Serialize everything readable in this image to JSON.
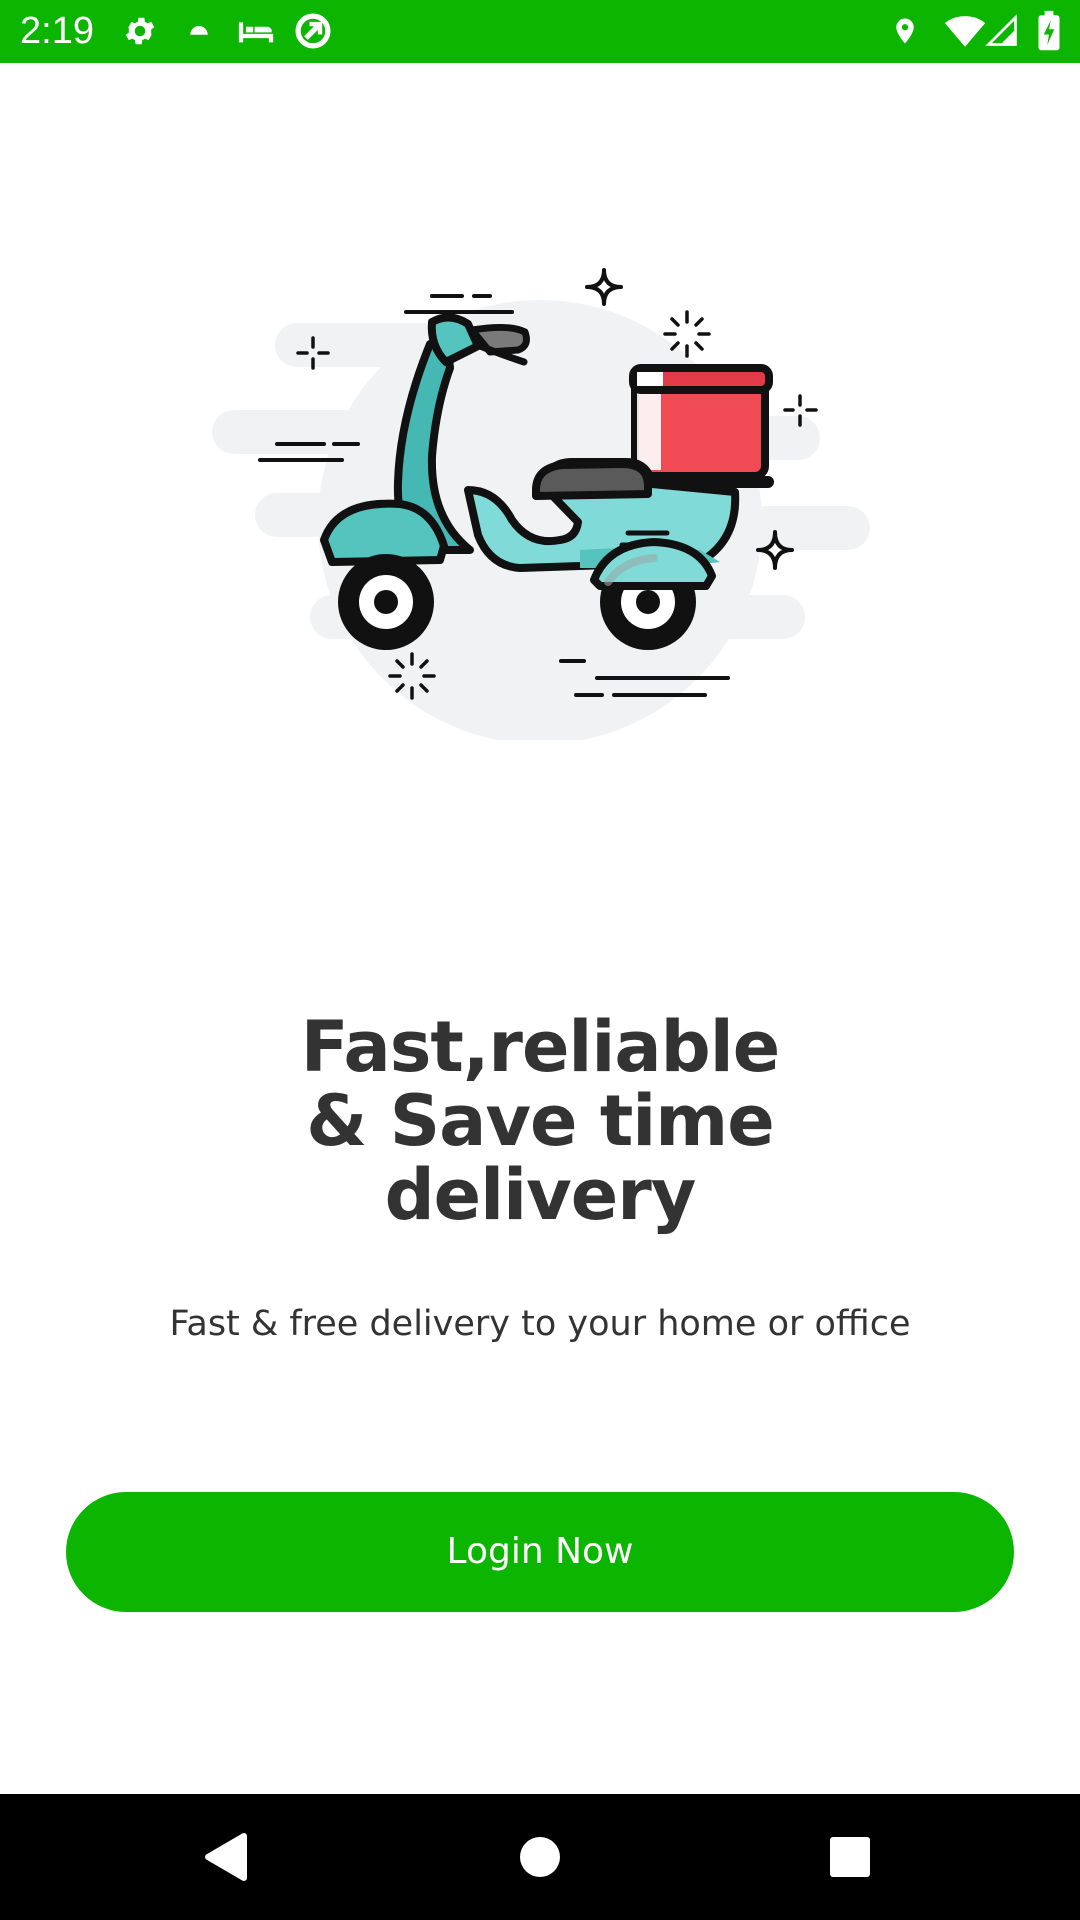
{
  "status_bar": {
    "time": "2:19",
    "background": "#0cb500",
    "left_icons": [
      "gear-icon",
      "android-icon",
      "bed-icon",
      "data-saver-icon"
    ],
    "right_icons": [
      "location-icon",
      "wifi-icon",
      "signal-icon",
      "battery-charging-icon"
    ]
  },
  "onboarding": {
    "illustration": "delivery-scooter-icon",
    "headline_lines": [
      "Fast,reliable",
      "& Save time",
      "delivery"
    ],
    "subtitle": "Fast & free delivery to your home or office"
  },
  "login_button": {
    "label": "Login Now",
    "color": "#0cb500"
  },
  "nav_bar": {
    "buttons": [
      "back-icon",
      "home-icon",
      "recents-icon"
    ]
  }
}
